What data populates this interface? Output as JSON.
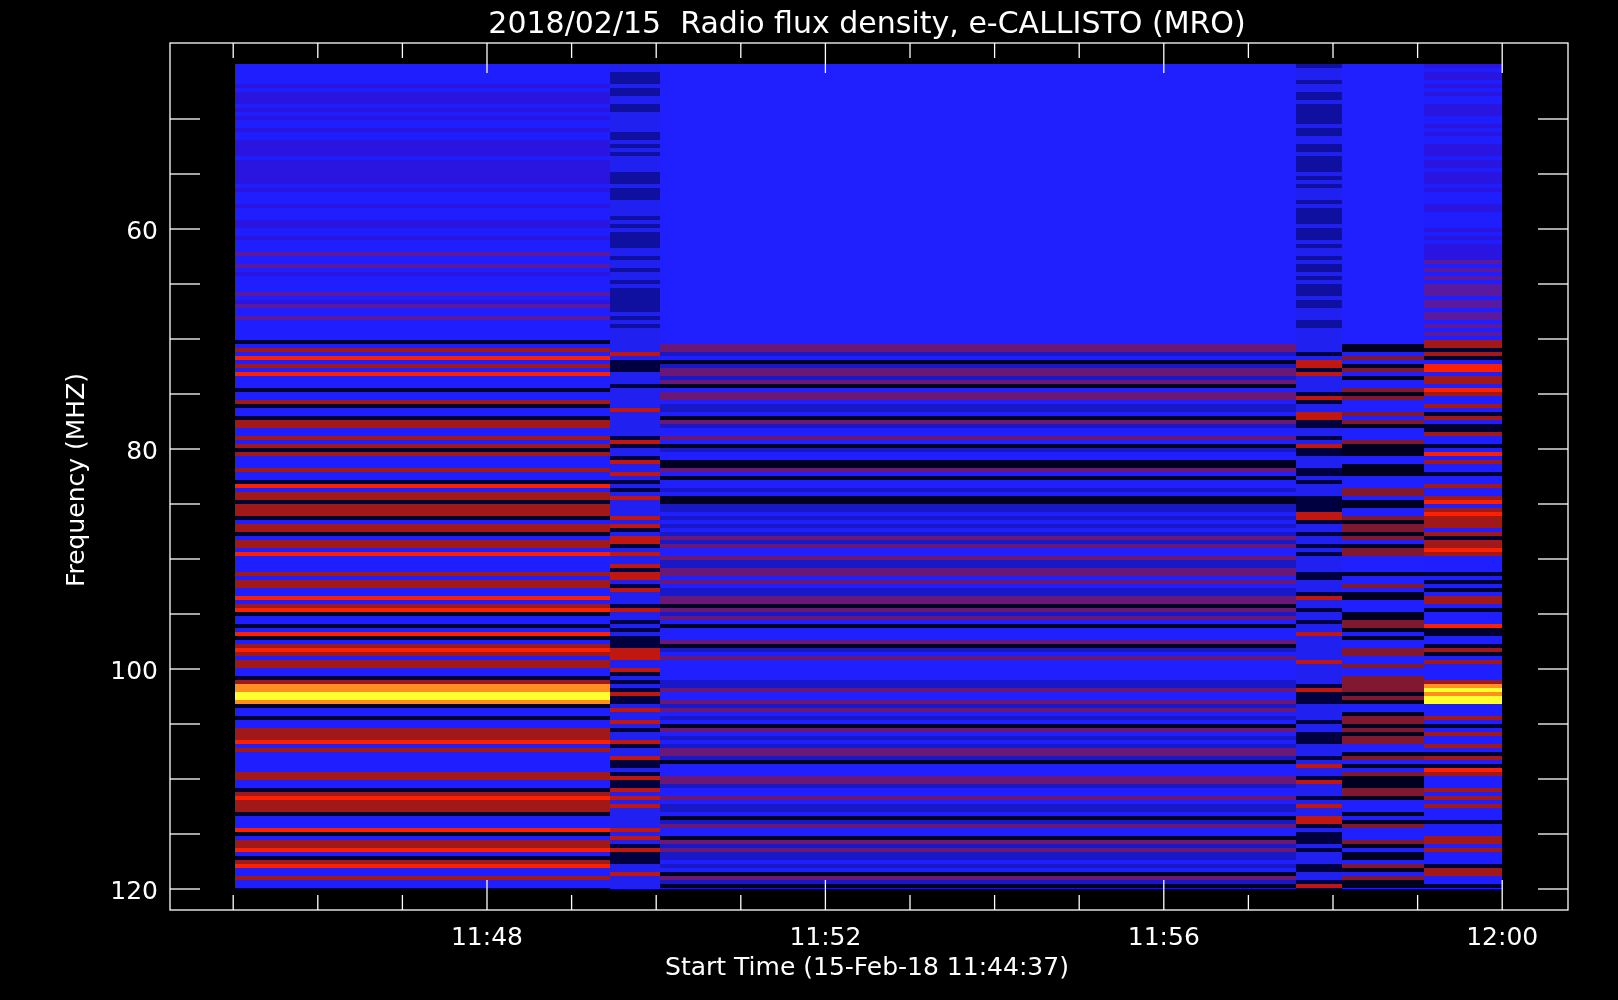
{
  "title": "2018/02/15  Radio flux density, e-CALLISTO (MRO)",
  "y_axis": {
    "label": "Frequency (MHZ)",
    "ticks": [
      "60",
      "80",
      "100",
      "120"
    ]
  },
  "x_axis": {
    "label": "Start Time (15-Feb-18 11:44:37)",
    "ticks": [
      "11:48",
      "11:52",
      "11:56",
      "12:00"
    ]
  }
}
